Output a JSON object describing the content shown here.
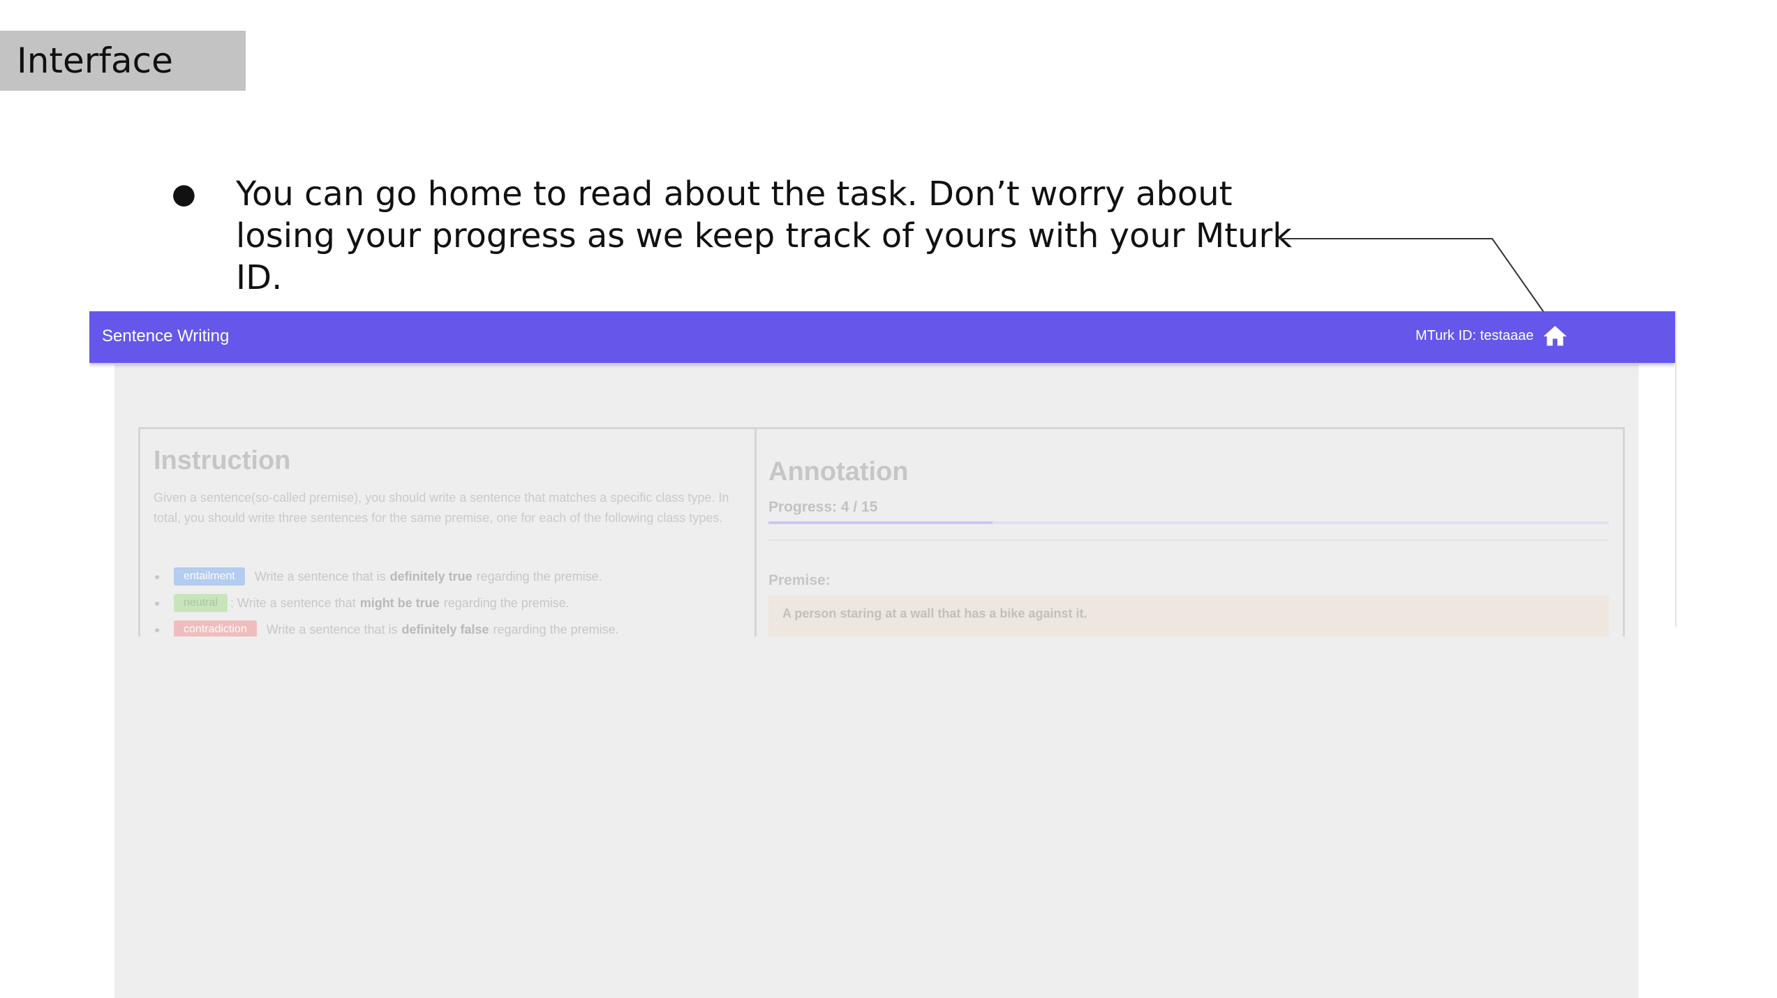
{
  "slide": {
    "title": "Interface",
    "bullet_symbol": "●",
    "bullet_text": "You can go home to read about the task. Don’t worry about losing your progress as we keep track of yours with your Mturk ID."
  },
  "app": {
    "title": "Sentence Writing",
    "mturk_id_text": "MTurk ID: testaaae",
    "home_icon": "home-icon",
    "accent_color": "#6457ea"
  },
  "instruction": {
    "heading": "Instruction",
    "description": "Given a sentence(so-called premise), you should write a sentence that matches a specific class type. In total, you should write three sentences for the same premise, one for each of the following class types.",
    "classes": [
      {
        "chip": "entailment",
        "pre": "Write a sentence that is",
        "bold": "definitely true",
        "post": "regarding the premise."
      },
      {
        "chip": "neutral",
        "pre": ": Write a sentence that",
        "bold": "might be true",
        "post": "regarding the premise."
      },
      {
        "chip": "contradiction",
        "pre": "Write a sentence that is",
        "bold": "definitely false",
        "post": "regarding the premise."
      }
    ]
  },
  "annotation": {
    "heading": "Annotation",
    "progress_text": "Progress: 4 / 15",
    "progress_fraction": 0.2667,
    "premise_label": "Premise:",
    "premise_text": "A person staring at a wall that has a bike against it."
  }
}
